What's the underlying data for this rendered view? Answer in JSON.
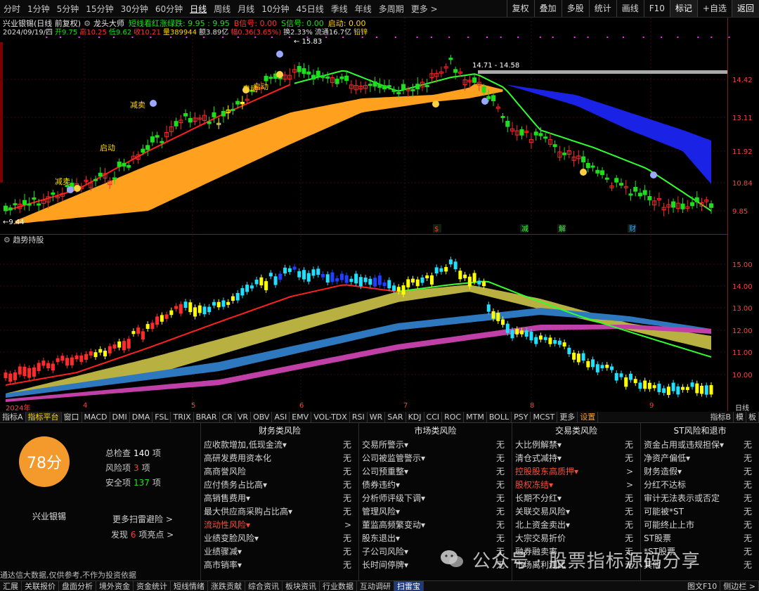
{
  "toolbar": {
    "periods": [
      "分时",
      "1分钟",
      "5分钟",
      "15分钟",
      "30分钟",
      "60分钟",
      "日线",
      "周线",
      "月线",
      "10分钟",
      "45日线",
      "季线",
      "年线",
      "多周期",
      "更多 >"
    ],
    "active_period": "日线",
    "right_tabs": [
      "复权",
      "叠加",
      "多股",
      "统计",
      "画线",
      "F10",
      "标记",
      "+自选",
      "返回"
    ]
  },
  "stock": {
    "title": "兴业银锡(日线 前复权)",
    "indicator": "龙头大师",
    "indicator_params": "短线看红涨绿跌: 9.95 : 9.95",
    "signal_b": "B信号: 0.00",
    "signal_s": "S信号: 0.00",
    "start": "启动: 0.00",
    "date": "2024/09/19/四",
    "open": "开9.75",
    "high": "高10.25",
    "low": "低9.62",
    "close": "收10.21",
    "volume": "量389944",
    "amount": "额3.89亿",
    "change": "幅0.36(3.65%)",
    "turnover": "换2.33%",
    "float": "流通16.7亿",
    "sector": "铅锌"
  },
  "main_chart": {
    "price_axis": [
      "14.42",
      "13.11",
      "11.92",
      "10.84",
      "9.85"
    ],
    "labels": {
      "high": "15.83",
      "low": "9.44",
      "range": "14.71 - 14.58"
    },
    "signals": [
      "启动",
      "减卖",
      "减卖",
      "启动",
      "自动"
    ],
    "markers": [
      "$",
      "减",
      "解",
      "财"
    ]
  },
  "sub_chart": {
    "title": "趋势持股",
    "price_axis": [
      "15.00",
      "14.00",
      "13.00",
      "12.00",
      "11.00",
      "10.00"
    ]
  },
  "date_axis": {
    "year": "2024年",
    "months": [
      "4",
      "5",
      "6",
      "7",
      "8",
      "9"
    ],
    "right_label": "日线"
  },
  "indicator_tabs": [
    "指标A",
    "指标平台",
    "窗口",
    "MACD",
    "DMI",
    "DMA",
    "FSL",
    "TRIX",
    "BRAR",
    "CR",
    "VR",
    "OBV",
    "ASI",
    "EMV",
    "VOL-TDX",
    "RSI",
    "WR",
    "SAR",
    "KDJ",
    "CCI",
    "ROC",
    "MTM",
    "BOLL",
    "PSY",
    "MCST",
    "更多",
    "设置"
  ],
  "indicator_right": [
    "指标B",
    "模",
    "板"
  ],
  "risk": {
    "score": "78分",
    "stock_name": "兴业银锡",
    "total_check_label": "总检查",
    "total_check": "140",
    "risk_items_label": "风险项",
    "risk_items": "3",
    "safe_items_label": "安全项",
    "safe_items": "137",
    "unit": "项",
    "more_scan": "更多扫雷避险 >",
    "found_pre": "发现",
    "found_num": "6",
    "found_post": "项亮点 >",
    "disclaimer": "通达信大数据,仅供参考,不作为投资依据",
    "columns": [
      {
        "title": "财务类风险",
        "rows": [
          {
            "label": "应收款增加,低现金流▾",
            "status": "无"
          },
          {
            "label": "高研发费用资本化",
            "status": "无"
          },
          {
            "label": "高商誉风险",
            "status": "无"
          },
          {
            "label": "应付债务占比高▾",
            "status": "无"
          },
          {
            "label": "高销售费用▾",
            "status": "无"
          },
          {
            "label": "最大供应商采购占比高▾",
            "status": "无"
          },
          {
            "label": "流动性风险▾",
            "status": ">",
            "warn": true
          },
          {
            "label": "业绩变脸风险▾",
            "status": "无"
          },
          {
            "label": "业绩骤减▾",
            "status": "无"
          },
          {
            "label": "高市销率▾",
            "status": "无"
          }
        ]
      },
      {
        "title": "市场类风险",
        "rows": [
          {
            "label": "交易所警示▾",
            "status": "无"
          },
          {
            "label": "公司被监管警示▾",
            "status": "无"
          },
          {
            "label": "公司预重整▾",
            "status": "无"
          },
          {
            "label": "债券违约▾",
            "status": "无"
          },
          {
            "label": "分析师评级下调▾",
            "status": "无"
          },
          {
            "label": "管理风险▾",
            "status": "无"
          },
          {
            "label": "董监高频繁变动▾",
            "status": "无"
          },
          {
            "label": "股东退出▾",
            "status": "无"
          },
          {
            "label": "子公司风险▾",
            "status": "无"
          },
          {
            "label": "长时间停牌▾",
            "status": "无"
          }
        ]
      },
      {
        "title": "交易类风险",
        "rows": [
          {
            "label": "大比例解禁▾",
            "status": "无"
          },
          {
            "label": "清仓式减持▾",
            "status": "无"
          },
          {
            "label": "控股股东高质押▾",
            "status": ">",
            "warn": true
          },
          {
            "label": "股权冻结▾",
            "status": ">",
            "warn": true
          },
          {
            "label": "长期不分红▾",
            "status": "无"
          },
          {
            "label": "关联交易风险▾",
            "status": "无"
          },
          {
            "label": "北上资金卖出▾",
            "status": "无"
          },
          {
            "label": "大宗交易折价",
            "status": "无"
          },
          {
            "label": "融券融卖率",
            "status": "无"
          },
          {
            "label": "市场离利润比",
            "status": "无"
          }
        ]
      },
      {
        "title": "ST风险和退市",
        "rows": [
          {
            "label": "资金占用或违规担保▾",
            "status": "无"
          },
          {
            "label": "净资产偏低▾",
            "status": "无"
          },
          {
            "label": "财务造假▾",
            "status": "无"
          },
          {
            "label": "分红不达标",
            "status": "无"
          },
          {
            "label": "审计无法表示或否定",
            "status": "无"
          },
          {
            "label": "可能被*ST",
            "status": "无"
          },
          {
            "label": "可能终止上市",
            "status": "无"
          },
          {
            "label": "ST股票",
            "status": "无"
          },
          {
            "label": "*ST股票",
            "status": "无"
          },
          {
            "label": "其他",
            "status": "无"
          }
        ]
      }
    ]
  },
  "bottom_tabs": [
    "汇展",
    "关联报价",
    "盘面分析",
    "境外资金",
    "资金统计",
    "短线情绪",
    "涨跌贡献",
    "综合资讯",
    "板块资讯",
    "行业数据",
    "互动调研",
    "扫雷宝"
  ],
  "bottom_right": [
    "图文F10",
    "侧边栏 >"
  ],
  "watermark": "公众号 · 股票指标源码分享",
  "colors": {
    "up": "#ff2a2a",
    "down": "#1de01d",
    "band_orange": "#ffa01e",
    "band_blue": "#1a22e6",
    "olive": "#b8b040",
    "steel": "#2e78c0",
    "magenta": "#c040a8",
    "yellow": "#ffff00",
    "cyan": "#20e0ff"
  }
}
